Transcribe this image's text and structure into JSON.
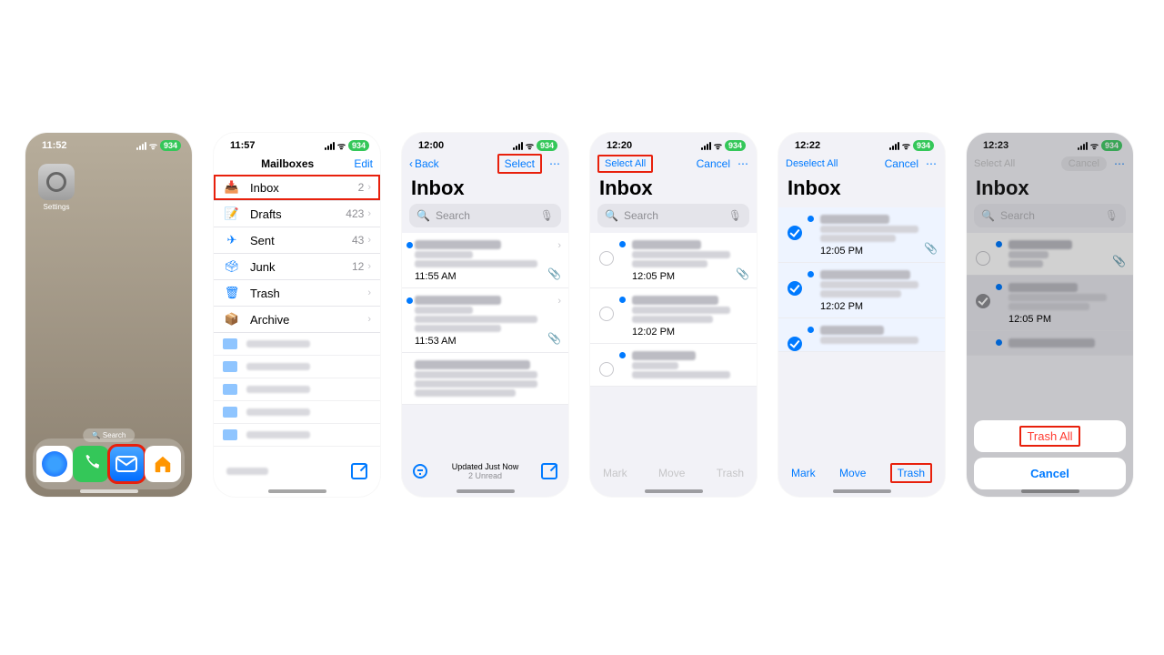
{
  "status": {
    "wifi": "􀙇",
    "batt": "934"
  },
  "home": {
    "time": "11:52",
    "settings_label": "Settings",
    "search_label": "🔍 Search"
  },
  "mailboxes": {
    "time": "11:57",
    "title": "Mailboxes",
    "edit": "Edit",
    "rows": [
      {
        "name": "Inbox",
        "count": "2"
      },
      {
        "name": "Drafts",
        "count": "423"
      },
      {
        "name": "Sent",
        "count": "43"
      },
      {
        "name": "Junk",
        "count": "12"
      },
      {
        "name": "Trash",
        "count": ""
      },
      {
        "name": "Archive",
        "count": ""
      }
    ]
  },
  "inbox": {
    "time": "12:00",
    "back": "Back",
    "select": "Select",
    "title": "Inbox",
    "search_ph": "Search",
    "msgs": [
      {
        "time": "11:55 AM"
      },
      {
        "time": "11:53 AM"
      },
      {
        "time": ""
      }
    ],
    "status": "Updated Just Now",
    "substatus": "2 Unread"
  },
  "edit1": {
    "time": "12:20",
    "select_all": "Select All",
    "cancel": "Cancel",
    "title": "Inbox",
    "msgs": [
      {
        "time": "12:05 PM"
      },
      {
        "time": "12:02 PM"
      },
      {
        "time": ""
      }
    ],
    "mark": "Mark",
    "move": "Move",
    "trash": "Trash"
  },
  "edit2": {
    "time": "12:22",
    "deselect_all": "Deselect All",
    "cancel": "Cancel",
    "title": "Inbox",
    "msgs": [
      {
        "time": "12:05 PM"
      },
      {
        "time": "12:02 PM"
      },
      {
        "time": ""
      }
    ],
    "mark": "Mark",
    "move": "Move",
    "trash": "Trash"
  },
  "sheet": {
    "time": "12:23",
    "select_all": "Select All",
    "cancel_top": "Cancel",
    "title": "Inbox",
    "msgs": [
      {
        "time": ""
      },
      {
        "time": "12:05 PM"
      },
      {
        "time": ""
      }
    ],
    "trash_all": "Trash All",
    "cancel": "Cancel"
  }
}
